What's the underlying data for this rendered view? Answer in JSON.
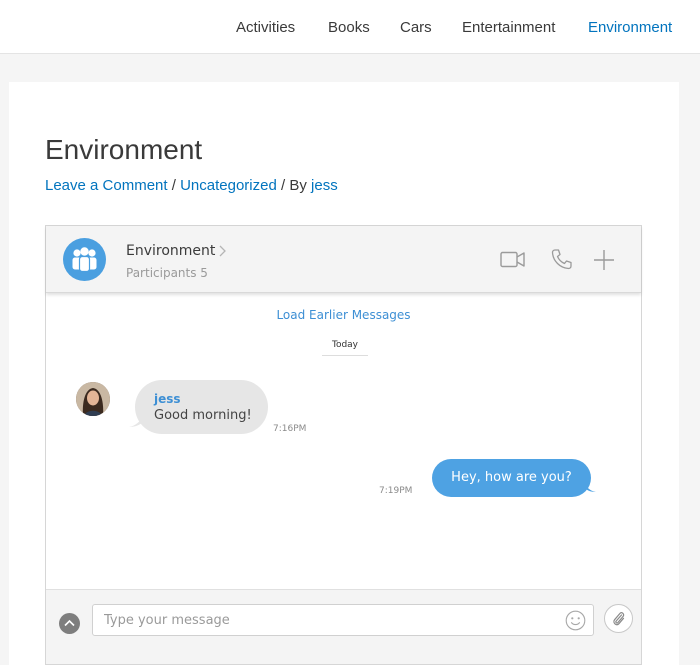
{
  "nav": {
    "items": [
      {
        "label": "Activities",
        "active": false
      },
      {
        "label": "Books",
        "active": false
      },
      {
        "label": "Cars",
        "active": false
      },
      {
        "label": "Entertainment",
        "active": false
      },
      {
        "label": "Environment",
        "active": true
      }
    ]
  },
  "post": {
    "title": "Environment",
    "meta": {
      "leave_comment": "Leave a Comment",
      "sep1": " / ",
      "category": "Uncategorized",
      "sep2": " / By ",
      "author": "jess"
    }
  },
  "chat": {
    "header": {
      "group_name": "Environment",
      "participants": "Participants 5",
      "icons": [
        "video-camera-icon",
        "phone-icon",
        "plus-icon"
      ]
    },
    "load_earlier": "Load Earlier Messages",
    "day_separator": "Today",
    "messages": [
      {
        "direction": "incoming",
        "sender": "jess",
        "text": "Good morning!",
        "time": "7:16PM"
      },
      {
        "direction": "outgoing",
        "text": "Hey, how are you?",
        "time": "7:19PM"
      }
    ],
    "composer": {
      "placeholder": "Type your message",
      "value": ""
    }
  },
  "colors": {
    "accent": "#0274be",
    "chat_blue": "#4ea2e3",
    "incoming_bubble": "#e6e6e6"
  }
}
